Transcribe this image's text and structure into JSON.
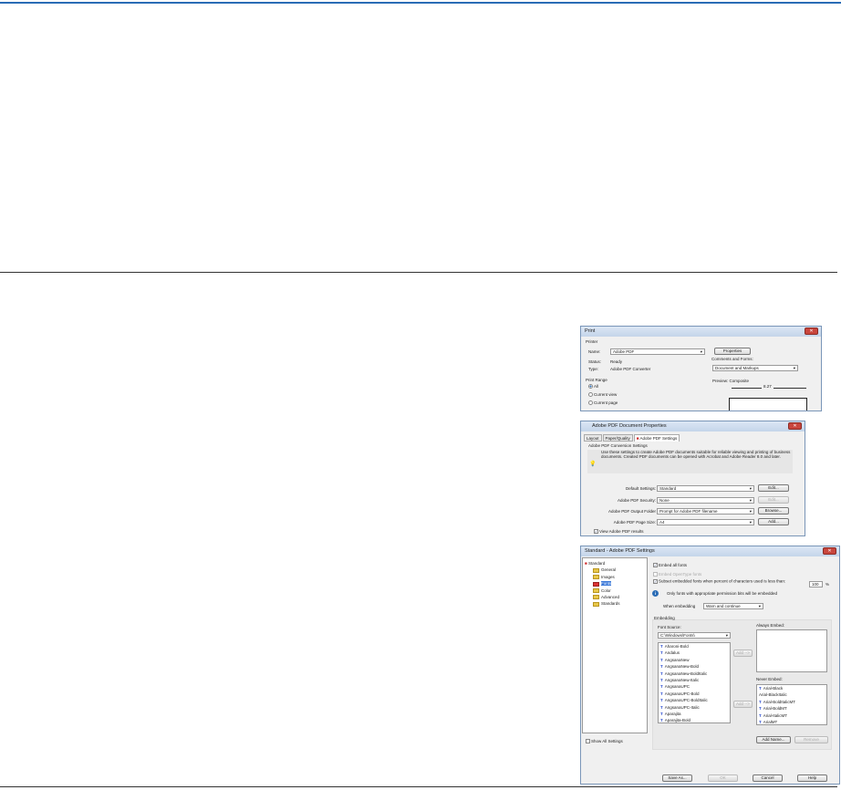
{
  "print_dialog": {
    "title": "Print",
    "printer_group": "Printer",
    "name_label": "Name:",
    "name_value": "Adobe PDF",
    "properties_button": "Properties",
    "status_label": "Status:",
    "status_value": "Ready",
    "type_label": "Type:",
    "type_value": "Adobe PDF Converter",
    "comments_label": "Comments and Forms:",
    "comments_value": "Document and Markups",
    "range_group": "Print Range",
    "range_options": [
      "All",
      "Current view",
      "Current page"
    ],
    "preview_label": "Preview: Composite",
    "preview_width": "8.27"
  },
  "props_dialog": {
    "title": "Adobe PDF Document Properties",
    "tabs": [
      "Layout",
      "Paper/Quality",
      "Adobe PDF Settings"
    ],
    "group": "Adobe PDF Conversion Settings",
    "description": "Use these settings to create Adobe PDF documents suitable for reliable viewing and printing of business documents. Created PDF documents can be opened with Acrobat and Adobe Reader 8.0 and later.",
    "rows": [
      {
        "label": "Default Settings:",
        "value": "Standard",
        "button": "Edit..."
      },
      {
        "label": "Adobe PDF Security:",
        "value": "None",
        "button": "Edit..."
      },
      {
        "label": "Adobe PDF Output Folder",
        "value": "Prompt for Adobe PDF filename",
        "button": "Browse..."
      },
      {
        "label": "Adobe PDF Page Size:",
        "value": "A4",
        "button": "Add..."
      }
    ],
    "view_results": "View Adobe PDF results"
  },
  "settings_dialog": {
    "title": "Standard - Adobe PDF Settings",
    "tree_root": "Standard",
    "tree_items": [
      "General",
      "Images",
      "Fonts",
      "Color",
      "Advanced",
      "Standards"
    ],
    "embed_all": "Embed all fonts",
    "embed_opentype": "Embed OpenType fonts",
    "subset_label": "Subset embedded fonts when percent of characters used is less than:",
    "subset_value": "100",
    "subset_unit": "%",
    "info_text": "Only fonts with appropriate permission bits will be embedded",
    "when_embedding_label": "When embedding",
    "when_embedding_value": "Warn and continue",
    "embedding_group": "Embedding",
    "font_source_label": "Font Source:",
    "font_source_value": "C:\\Windows\\Fonts\\",
    "fonts": [
      "Aharoni-Bold",
      "Andalus",
      "AngsanaNew",
      "AngsanaNew-Bold",
      "AngsanaNew-BoldItalic",
      "AngsanaNew-Italic",
      "AngsanaUPC",
      "AngsanaUPC-Bold",
      "AngsanaUPC-BoldItalic",
      "AngsanaUPC-Italic",
      "Aparajita",
      "Aparajita-Bold"
    ],
    "add_button": "Add -->",
    "always_embed_label": "Always Embed:",
    "never_embed_label": "Never Embed:",
    "never_embed": [
      "Arial-Black",
      "Arial-BlackItalic",
      "Arial-BoldItalicMT",
      "Arial-BoldMT",
      "Arial-ItalicMT",
      "ArialMT"
    ],
    "add_name_button": "Add Name...",
    "remove_button": "Remove",
    "show_all": "Show All Settings",
    "save_as_button": "Save As...",
    "ok_button": "OK",
    "cancel_button": "Cancel",
    "help_button": "Help"
  }
}
